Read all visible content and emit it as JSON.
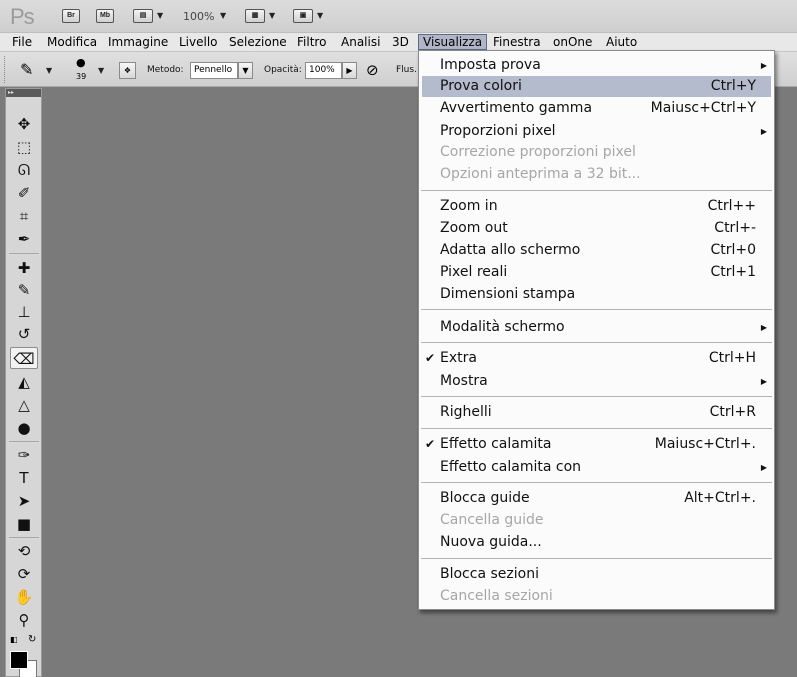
{
  "app": {
    "logo": "Ps",
    "bridge_label": "Br",
    "minibridge_label": "Mb",
    "zoom": "100%"
  },
  "menubar": [
    "File",
    "Modifica",
    "Immagine",
    "Livello",
    "Selezione",
    "Filtro",
    "Analisi",
    "3D",
    "Visualizza",
    "Finestra",
    "onOne",
    "Aiuto"
  ],
  "options": {
    "brush_size": "39",
    "method_label": "Metodo:",
    "method_value": "Pennello",
    "opacity_label": "Opacità:",
    "opacity_value": "100%",
    "flow_label": "Flus."
  },
  "tools": [
    "move-tool-icon",
    "marquee-tool-icon",
    "lasso-tool-icon",
    "quick-selection-tool-icon",
    "crop-tool-icon",
    "eyedropper-tool-icon",
    "healing-brush-tool-icon",
    "brush-tool-icon",
    "clone-stamp-tool-icon",
    "history-brush-tool-icon",
    "eraser-tool-icon",
    "paint-bucket-tool-icon",
    "blur-tool-icon",
    "dodge-tool-icon",
    "pen-tool-icon",
    "type-tool-icon",
    "path-selection-tool-icon",
    "rectangle-tool-icon",
    "3d-rotate-tool-icon",
    "3d-orbit-tool-icon",
    "hand-tool-icon",
    "zoom-tool-icon"
  ],
  "menu": {
    "items": [
      {
        "label": "Imposta prova",
        "shortcut": "",
        "submenu": true,
        "disabled": false,
        "checked": false,
        "highlight": false
      },
      {
        "label": "Prova colori",
        "shortcut": "Ctrl+Y",
        "submenu": false,
        "disabled": false,
        "checked": false,
        "highlight": true
      },
      {
        "label": "Avvertimento gamma",
        "shortcut": "Maiusc+Ctrl+Y",
        "submenu": false,
        "disabled": false,
        "checked": false,
        "highlight": false
      },
      {
        "label": "Proporzioni pixel",
        "shortcut": "",
        "submenu": true,
        "disabled": false,
        "checked": false,
        "highlight": false
      },
      {
        "label": "Correzione proporzioni pixel",
        "shortcut": "",
        "submenu": false,
        "disabled": true,
        "checked": false,
        "highlight": false
      },
      {
        "label": "Opzioni anteprima a 32 bit...",
        "shortcut": "",
        "submenu": false,
        "disabled": true,
        "checked": false,
        "highlight": false
      },
      {
        "label": "Zoom in",
        "shortcut": "Ctrl++",
        "submenu": false,
        "disabled": false,
        "checked": false,
        "highlight": false
      },
      {
        "label": "Zoom out",
        "shortcut": "Ctrl+-",
        "submenu": false,
        "disabled": false,
        "checked": false,
        "highlight": false
      },
      {
        "label": "Adatta allo schermo",
        "shortcut": "Ctrl+0",
        "submenu": false,
        "disabled": false,
        "checked": false,
        "highlight": false
      },
      {
        "label": "Pixel reali",
        "shortcut": "Ctrl+1",
        "submenu": false,
        "disabled": false,
        "checked": false,
        "highlight": false
      },
      {
        "label": "Dimensioni stampa",
        "shortcut": "",
        "submenu": false,
        "disabled": false,
        "checked": false,
        "highlight": false
      },
      {
        "label": "Modalità schermo",
        "shortcut": "",
        "submenu": true,
        "disabled": false,
        "checked": false,
        "highlight": false
      },
      {
        "label": "Extra",
        "shortcut": "Ctrl+H",
        "submenu": false,
        "disabled": false,
        "checked": true,
        "highlight": false
      },
      {
        "label": "Mostra",
        "shortcut": "",
        "submenu": true,
        "disabled": false,
        "checked": false,
        "highlight": false
      },
      {
        "label": "Righelli",
        "shortcut": "Ctrl+R",
        "submenu": false,
        "disabled": false,
        "checked": false,
        "highlight": false
      },
      {
        "label": "Effetto calamita",
        "shortcut": "Maiusc+Ctrl+.",
        "submenu": false,
        "disabled": false,
        "checked": true,
        "highlight": false
      },
      {
        "label": "Effetto calamita con",
        "shortcut": "",
        "submenu": true,
        "disabled": false,
        "checked": false,
        "highlight": false
      },
      {
        "label": "Blocca guide",
        "shortcut": "Alt+Ctrl+.",
        "submenu": false,
        "disabled": false,
        "checked": false,
        "highlight": false
      },
      {
        "label": "Cancella guide",
        "shortcut": "",
        "submenu": false,
        "disabled": true,
        "checked": false,
        "highlight": false
      },
      {
        "label": "Nuova guida...",
        "shortcut": "",
        "submenu": false,
        "disabled": false,
        "checked": false,
        "highlight": false
      },
      {
        "label": "Blocca sezioni",
        "shortcut": "",
        "submenu": false,
        "disabled": false,
        "checked": false,
        "highlight": false
      },
      {
        "label": "Cancella sezioni",
        "shortcut": "",
        "submenu": false,
        "disabled": true,
        "checked": false,
        "highlight": false
      }
    ]
  },
  "colors": {
    "highlight": "#b4bbcc",
    "disabled_text": "#a6a6a6",
    "canvas": "#7a7a7a"
  }
}
